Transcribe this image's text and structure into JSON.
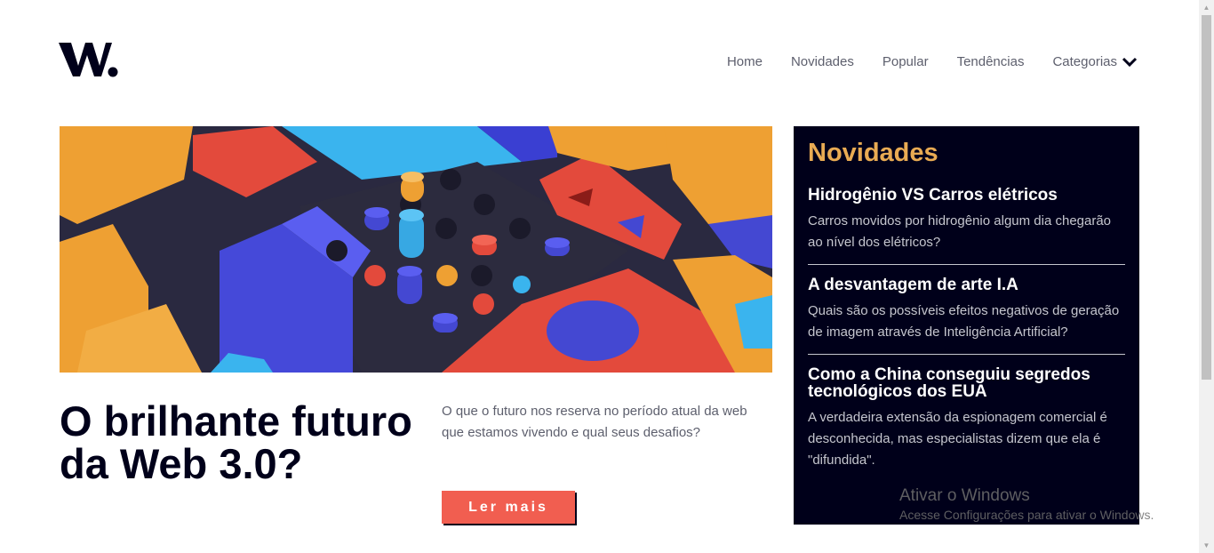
{
  "header": {
    "logo_text": "W.",
    "nav": [
      {
        "label": "Home"
      },
      {
        "label": "Novidades"
      },
      {
        "label": "Popular"
      },
      {
        "label": "Tendências"
      },
      {
        "label": "Categorias",
        "icon": "chevron-down-icon"
      }
    ]
  },
  "main": {
    "title": "O brilhante futuro da Web 3.0?",
    "description": "O que o futuro nos reserva no período atual da web que estamos vivendo e qual seus desafios?",
    "button_label": "Ler mais"
  },
  "sidebar": {
    "title": "Novidades",
    "items": [
      {
        "title": "Hidrogênio VS Carros elétricos",
        "text": "Carros movidos por hidrogênio algum dia chegarão ao nível dos elétricos?"
      },
      {
        "title": "A desvantagem de arte I.A",
        "text": "Quais são os possíveis efeitos negativos de geração de imagem através de Inteligência Artificial?"
      },
      {
        "title": "Como a China conseguiu segredos tecnológicos dos EUA",
        "text": "A verdadeira extensão da espionagem comercial é desconhecida, mas especialistas dizem que ela é \"difundida\"."
      }
    ]
  },
  "watermark": {
    "title": "Ativar o Windows",
    "subtitle": "Acesse Configurações para ativar o Windows."
  },
  "colors": {
    "dark_navy": "#00001a",
    "accent_orange": "#e9ab53",
    "button_red": "#f15e50",
    "text_gray": "#5d5f6d"
  }
}
